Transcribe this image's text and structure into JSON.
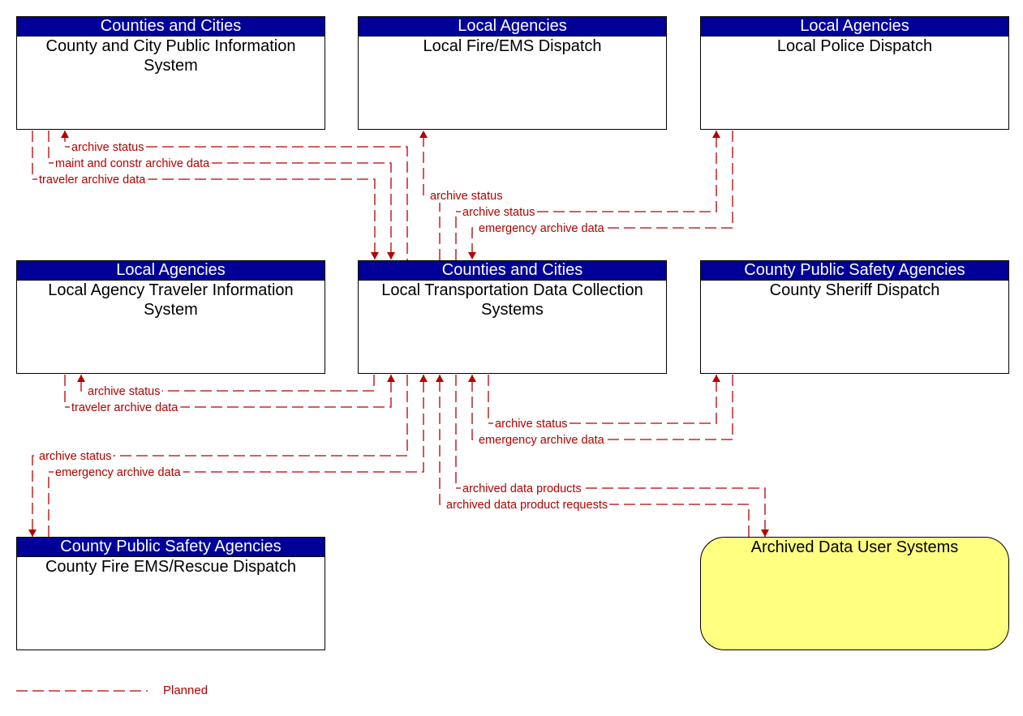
{
  "nodes": [
    {
      "id": "ccpis",
      "group": "Counties and Cities",
      "title": "County and City Public Information System",
      "type": "element"
    },
    {
      "id": "fire",
      "group": "Local Agencies",
      "title": "Local Fire/EMS Dispatch",
      "type": "element"
    },
    {
      "id": "police",
      "group": "Local Agencies",
      "title": "Local Police Dispatch",
      "type": "element"
    },
    {
      "id": "lat",
      "group": "Local Agencies",
      "title": "Local Agency Traveler Information System",
      "type": "element"
    },
    {
      "id": "ltdc",
      "group": "Counties and Cities",
      "title": "Local Transportation Data Collection Systems",
      "type": "element"
    },
    {
      "id": "sheriff",
      "group": "County Public Safety Agencies",
      "title": "County Sheriff Dispatch",
      "type": "element"
    },
    {
      "id": "cfems",
      "group": "County Public Safety Agencies",
      "title": "County Fire EMS/Rescue Dispatch",
      "type": "element"
    },
    {
      "id": "adus",
      "group": "",
      "title": "Archived Data User Systems",
      "type": "external"
    }
  ],
  "flows": [
    {
      "from": "ltdc",
      "to": "ccpis",
      "label": "archive status",
      "status": "Planned"
    },
    {
      "from": "ccpis",
      "to": "ltdc",
      "label": "maint and constr archive data",
      "status": "Planned"
    },
    {
      "from": "ccpis",
      "to": "ltdc",
      "label": "traveler archive data",
      "status": "Planned"
    },
    {
      "from": "ltdc",
      "to": "fire",
      "label": "archive status",
      "status": "Planned"
    },
    {
      "from": "ltdc",
      "to": "police",
      "label": "archive status",
      "status": "Planned"
    },
    {
      "from": "police",
      "to": "ltdc",
      "label": "emergency archive data",
      "status": "Planned"
    },
    {
      "from": "ltdc",
      "to": "lat",
      "label": "archive status",
      "status": "Planned"
    },
    {
      "from": "lat",
      "to": "ltdc",
      "label": "traveler archive data",
      "status": "Planned"
    },
    {
      "from": "ltdc",
      "to": "cfems",
      "label": "archive status",
      "status": "Planned"
    },
    {
      "from": "cfems",
      "to": "ltdc",
      "label": "emergency archive data",
      "status": "Planned"
    },
    {
      "from": "ltdc",
      "to": "sheriff",
      "label": "archive status",
      "status": "Planned"
    },
    {
      "from": "sheriff",
      "to": "ltdc",
      "label": "emergency archive data",
      "status": "Planned"
    },
    {
      "from": "ltdc",
      "to": "adus",
      "label": "archived data products",
      "status": "Planned"
    },
    {
      "from": "adus",
      "to": "ltdc",
      "label": "archived data product requests",
      "status": "Planned"
    }
  ],
  "legend": {
    "planned_label": "Planned"
  },
  "colors": {
    "header": "#000099",
    "flow": "#b30000",
    "external_fill": "#ffff80"
  }
}
